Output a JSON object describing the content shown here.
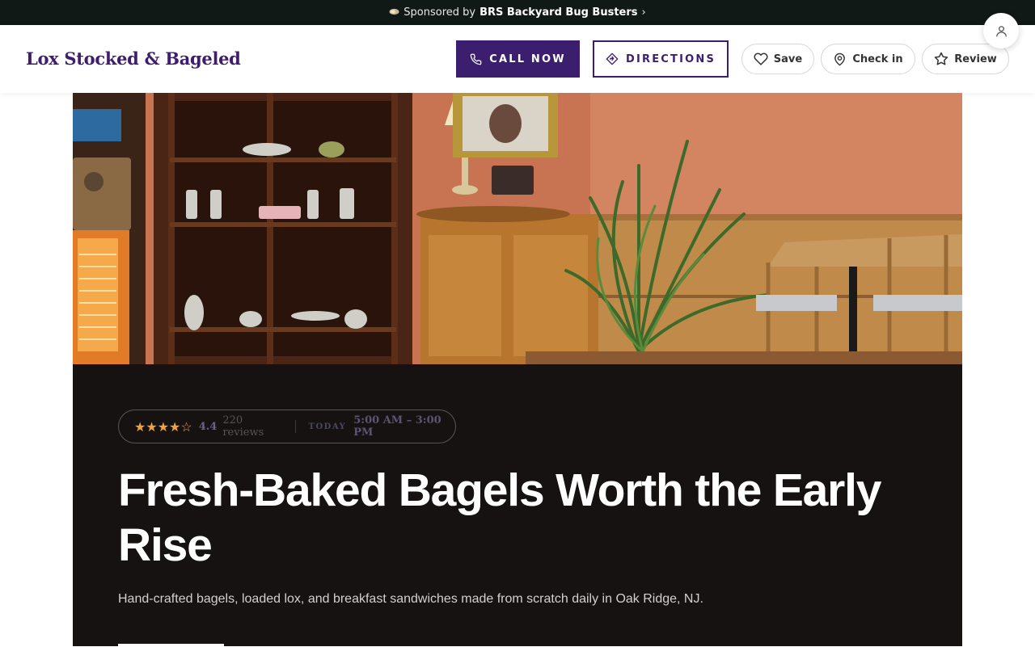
{
  "sponsor": {
    "prefix": "Sponsored by",
    "name": "BRS Backyard Bug Busters",
    "arrow": "›",
    "icon": "bug-emoji"
  },
  "header": {
    "brand": "Lox Stocked & Bageled",
    "call_label": "CALL NOW",
    "directions_label": "DIRECTIONS",
    "save_label": "Save",
    "checkin_label": "Check in",
    "review_label": "Review"
  },
  "hero": {
    "stars": "★★★★☆",
    "rating": "4.4",
    "reviews": "220 reviews",
    "today_label": "TODAY",
    "hours": "5:00 AM – 3:00 PM",
    "headline": "Fresh-Baked Bagels Worth the Early Rise",
    "subtext": "Hand-crafted bagels, loaded lox, and breakfast sandwiches made from scratch daily in Oak Ridge, NJ."
  },
  "colors": {
    "brand": "#3f1d6e",
    "accent": "#3b1f6e",
    "star": "#f0a33a",
    "dark_panel": "#151211"
  }
}
